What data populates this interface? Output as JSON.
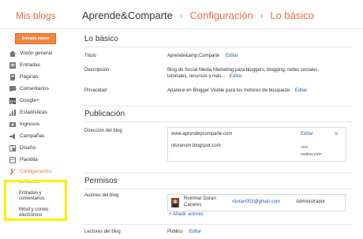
{
  "header": {
    "brand": "Mis blogs",
    "crumb1": "Aprende&Comparte",
    "crumb2": "Configuración",
    "crumb3": "Lo básico",
    "separator": "›"
  },
  "new_post": "Entrada nueva",
  "sidebar": {
    "items": [
      {
        "label": "Visión general",
        "icon": "home-icon",
        "color": "#777777"
      },
      {
        "label": "Entradas",
        "icon": "posts-icon",
        "color": "#777777"
      },
      {
        "label": "Páginas",
        "icon": "pages-icon",
        "color": "#777777"
      },
      {
        "label": "Comentarios",
        "icon": "comments-icon",
        "color": "#777777"
      },
      {
        "label": "Google+",
        "icon": "googleplus-icon",
        "color": "#555555"
      },
      {
        "label": "Estadísticas",
        "icon": "stats-icon",
        "color": "#777777"
      },
      {
        "label": "Ingresos",
        "icon": "earnings-icon",
        "color": "#777777"
      },
      {
        "label": "Campañas",
        "icon": "campaigns-icon",
        "color": "#777777"
      },
      {
        "label": "Diseño",
        "icon": "layout-icon",
        "color": "#777777"
      },
      {
        "label": "Plantilla",
        "icon": "template-icon",
        "color": "#777777"
      },
      {
        "label": "Configuración",
        "icon": "wrench-icon",
        "color": "#e8703a"
      }
    ],
    "sub": [
      "Lo básico",
      "Entradas y comentarios",
      "Móvil y correo electrónico"
    ]
  },
  "basico": {
    "title": "Lo básico",
    "titulo_label": "Título",
    "titulo_value": "Aprende&amp;Comparte",
    "descripcion_label": "Descripción",
    "descripcion_value": "Blog de Social Media Marketing para bloggers, blogging, redes sociales, tutoriales, recursos y más...",
    "privacidad_label": "Privacidad",
    "privacidad_value": "Aparece en Blogger Visible para los motores de búsqueda",
    "edit": "Editar"
  },
  "publicacion": {
    "title": "Publicación",
    "direccion_label": "Dirección del blog",
    "url1": "www.aprendeycomparte.com",
    "url2": "rduransm.blogspot.com",
    "con": "con",
    "redireccion": "redirección",
    "close": "✕"
  },
  "permisos": {
    "title": "Permisos",
    "autores_label": "Autores del blog",
    "author_name": "Roinmar Duran Caceres",
    "author_email": "rduran053@gmail.com",
    "author_role": "Administrador",
    "add_authors": "+ Añadir autores",
    "lectores_label": "Lectores del blog",
    "lectores_value": "Público",
    "edit": "Editar"
  },
  "colors": {
    "accent": "#e8703a",
    "link": "#2a5db0",
    "highlight": "#ffee00"
  }
}
